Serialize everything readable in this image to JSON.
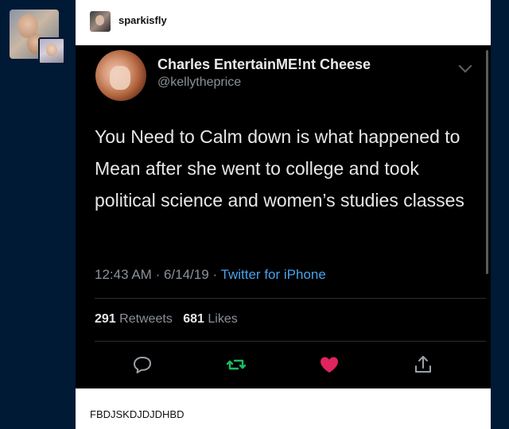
{
  "post": {
    "blog_name": "sparkisfly",
    "caption": "FBDJSKDJDJDHBD"
  },
  "tweet": {
    "display_name": "Charles EntertainME!nt Cheese",
    "handle": "@kellytheprice",
    "text": "You Need to Calm down is what happened to Mean after she went to college and took political science and women’s studies classes",
    "time": "12:43 AM",
    "date": "6/14/19",
    "separator": "·",
    "source": "Twitter for iPhone",
    "retweets_count": "291",
    "retweets_label": "Retweets",
    "likes_count": "681",
    "likes_label": "Likes"
  },
  "icons": {
    "reply": "reply-icon",
    "retweet": "retweet-icon",
    "like": "heart-icon",
    "share": "share-icon",
    "menu": "chevron-down-icon"
  },
  "colors": {
    "page_background": "#001935",
    "tweet_background": "#000000",
    "retweet_green": "#17bf63",
    "like_red": "#e0245e",
    "link_blue": "#4aa1eb"
  }
}
